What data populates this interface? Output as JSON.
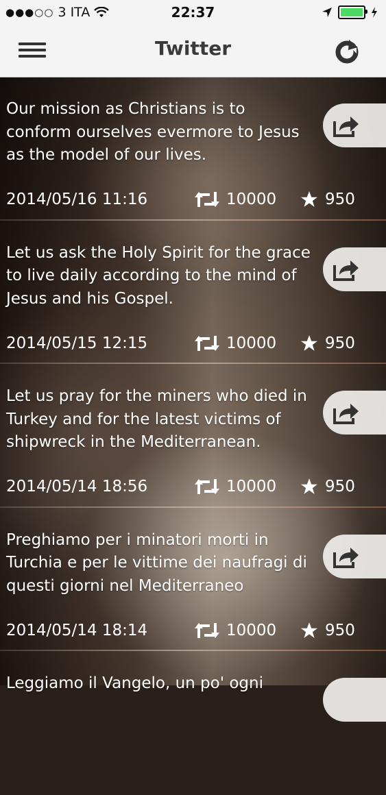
{
  "status_bar": {
    "carrier": "3 ITA",
    "time": "22:37"
  },
  "nav": {
    "title": "Twitter",
    "menu_icon": "hamburger-menu-icon",
    "refresh_icon": "refresh-icon"
  },
  "tweets": [
    {
      "text": "Our mission as Christians is to conform ourselves evermore to Jesus as the model of our lives.",
      "date": "2014/05/16 11:16",
      "retweets": "10000",
      "favorites": "950"
    },
    {
      "text": "Let us ask the Holy Spirit for the grace to live daily according to the mind of Jesus and his Gospel.",
      "date": "2014/05/15 12:15",
      "retweets": "10000",
      "favorites": "950"
    },
    {
      "text": "Let us pray for the miners who died in Turkey and for the latest victims of shipwreck in the Mediterranean.",
      "date": "2014/05/14 18:56",
      "retweets": "10000",
      "favorites": "950"
    },
    {
      "text": "Preghiamo per i minatori morti in Turchia e per le vittime dei naufragi di questi giorni nel Mediterraneo",
      "date": "2014/05/14 18:14",
      "retweets": "10000",
      "favorites": "950"
    },
    {
      "text": "Leggiamo il Vangelo, un po' ogni",
      "date": "",
      "retweets": "",
      "favorites": ""
    }
  ],
  "colors": {
    "battery": "#4cd964",
    "nav_background": "#f4f4f4"
  }
}
